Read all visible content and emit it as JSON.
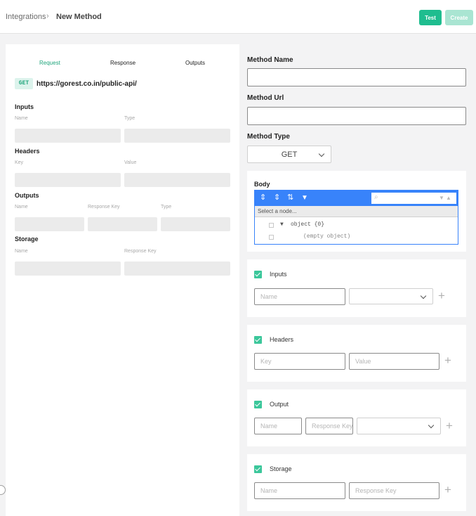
{
  "breadcrumb": {
    "root": "Integrations",
    "separator": "›",
    "current": "New Method"
  },
  "actions": {
    "test_label": "Test",
    "create_label": "Create"
  },
  "preview": {
    "tabs": [
      "Request",
      "Response",
      "Outputs"
    ],
    "active_tab": "Request",
    "method_badge": "GET",
    "url": "https://gorest.co.in/public-api/",
    "sections": {
      "inputs": {
        "title": "Inputs",
        "columns": [
          "Name",
          "Type"
        ]
      },
      "headers": {
        "title": "Headers",
        "columns": [
          "Key",
          "Value"
        ]
      },
      "outputs": {
        "title": "Outputs",
        "columns": [
          "Name",
          "Response Key",
          "Type"
        ]
      },
      "storage": {
        "title": "Storage",
        "columns": [
          "Name",
          "Response Key"
        ]
      }
    }
  },
  "form": {
    "method_name_label": "Method Name",
    "method_name_value": "",
    "method_url_label": "Method Url",
    "method_url_value": "",
    "method_type_label": "Method Type",
    "method_type_value": "GET",
    "body": {
      "title": "Body",
      "nav_placeholder": "Select a node...",
      "tree_root": "object {0}",
      "tree_empty": "(empty object)",
      "toolbar_icons": [
        "expand-all-icon",
        "collapse-all-icon",
        "sort-icon",
        "filter-icon"
      ],
      "toolbar_glyphs": [
        "⇕",
        "⇕",
        "⇅",
        "▼"
      ],
      "search_glyph": "⌕",
      "search_prev_glyph": "▼",
      "search_next_glyph": "▲",
      "tree_toggle_glyph": "▼"
    },
    "inputs": {
      "title": "Inputs",
      "checked": true,
      "name_placeholder": "Name",
      "add_glyph": "+"
    },
    "headers": {
      "title": "Headers",
      "checked": true,
      "key_placeholder": "Key",
      "value_placeholder": "Value",
      "add_glyph": "+"
    },
    "output": {
      "title": "Output",
      "checked": true,
      "name_placeholder": "Name",
      "response_key_placeholder": "Response Key",
      "add_glyph": "+"
    },
    "storage": {
      "title": "Storage",
      "checked": true,
      "name_placeholder": "Name",
      "response_key_placeholder": "Response Key",
      "add_glyph": "+"
    }
  },
  "colors": {
    "accent": "#1fbd8f",
    "accent_light": "#a9e5d2",
    "editor_blue": "#3883fa",
    "checkbox": "#3cc79b"
  }
}
